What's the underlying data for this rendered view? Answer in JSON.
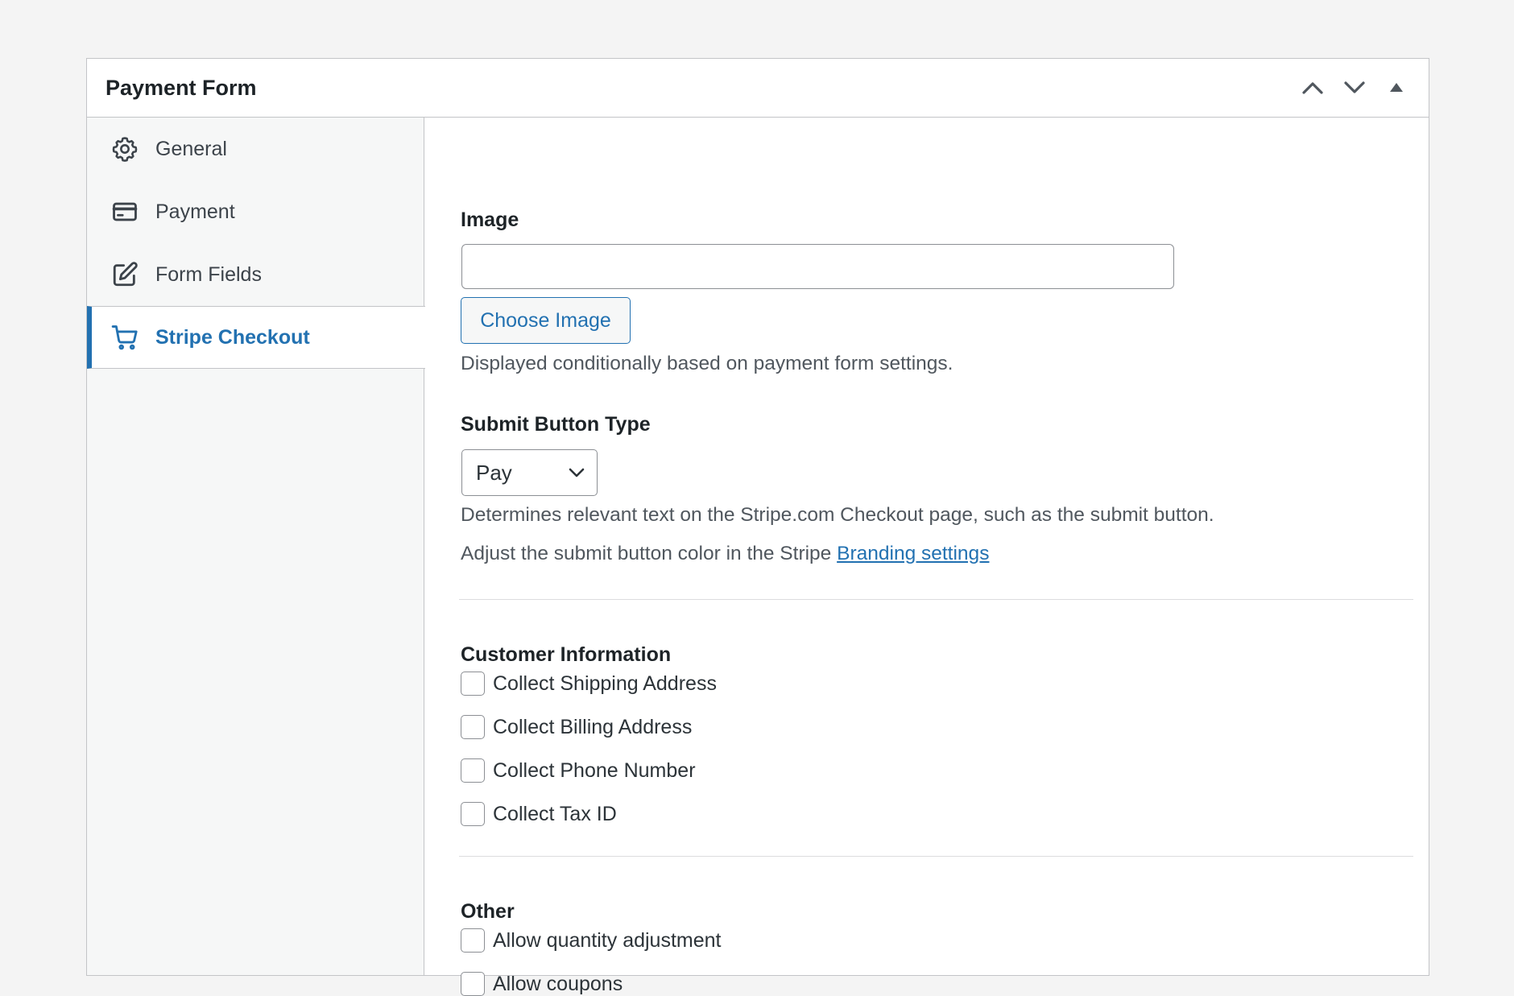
{
  "panel": {
    "title": "Payment Form",
    "controls": [
      "move-up",
      "move-down",
      "toggle-panel"
    ]
  },
  "sidebar": {
    "items": [
      {
        "label": "General",
        "icon": "gear-icon",
        "active": false
      },
      {
        "label": "Payment",
        "icon": "credit-card-icon",
        "active": false
      },
      {
        "label": "Form Fields",
        "icon": "edit-icon",
        "active": false
      },
      {
        "label": "Stripe Checkout",
        "icon": "cart-icon",
        "active": true
      }
    ]
  },
  "content": {
    "image": {
      "label": "Image",
      "value": "",
      "button_label": "Choose Image",
      "description": "Displayed conditionally based on payment form settings."
    },
    "submit_button_type": {
      "label": "Submit Button Type",
      "selected": "Pay",
      "description": "Determines relevant text on the Stripe.com Checkout page, such as the submit button.",
      "branding_prefix": "Adjust the submit button color in the Stripe ",
      "branding_link": "Branding settings"
    },
    "customer_information": {
      "heading": "Customer Information",
      "options": [
        {
          "label": "Collect Shipping Address",
          "checked": false
        },
        {
          "label": "Collect Billing Address",
          "checked": false
        },
        {
          "label": "Collect Phone Number",
          "checked": false
        },
        {
          "label": "Collect Tax ID",
          "checked": false
        }
      ]
    },
    "other": {
      "heading": "Other",
      "options": [
        {
          "label": "Allow quantity adjustment",
          "checked": false
        },
        {
          "label": "Allow coupons",
          "checked": false
        }
      ]
    }
  },
  "colors": {
    "accent": "#2271b1",
    "border": "#c3c4c7",
    "sidebar_bg": "#f6f7f7",
    "page_bg": "#f4f4f4"
  }
}
